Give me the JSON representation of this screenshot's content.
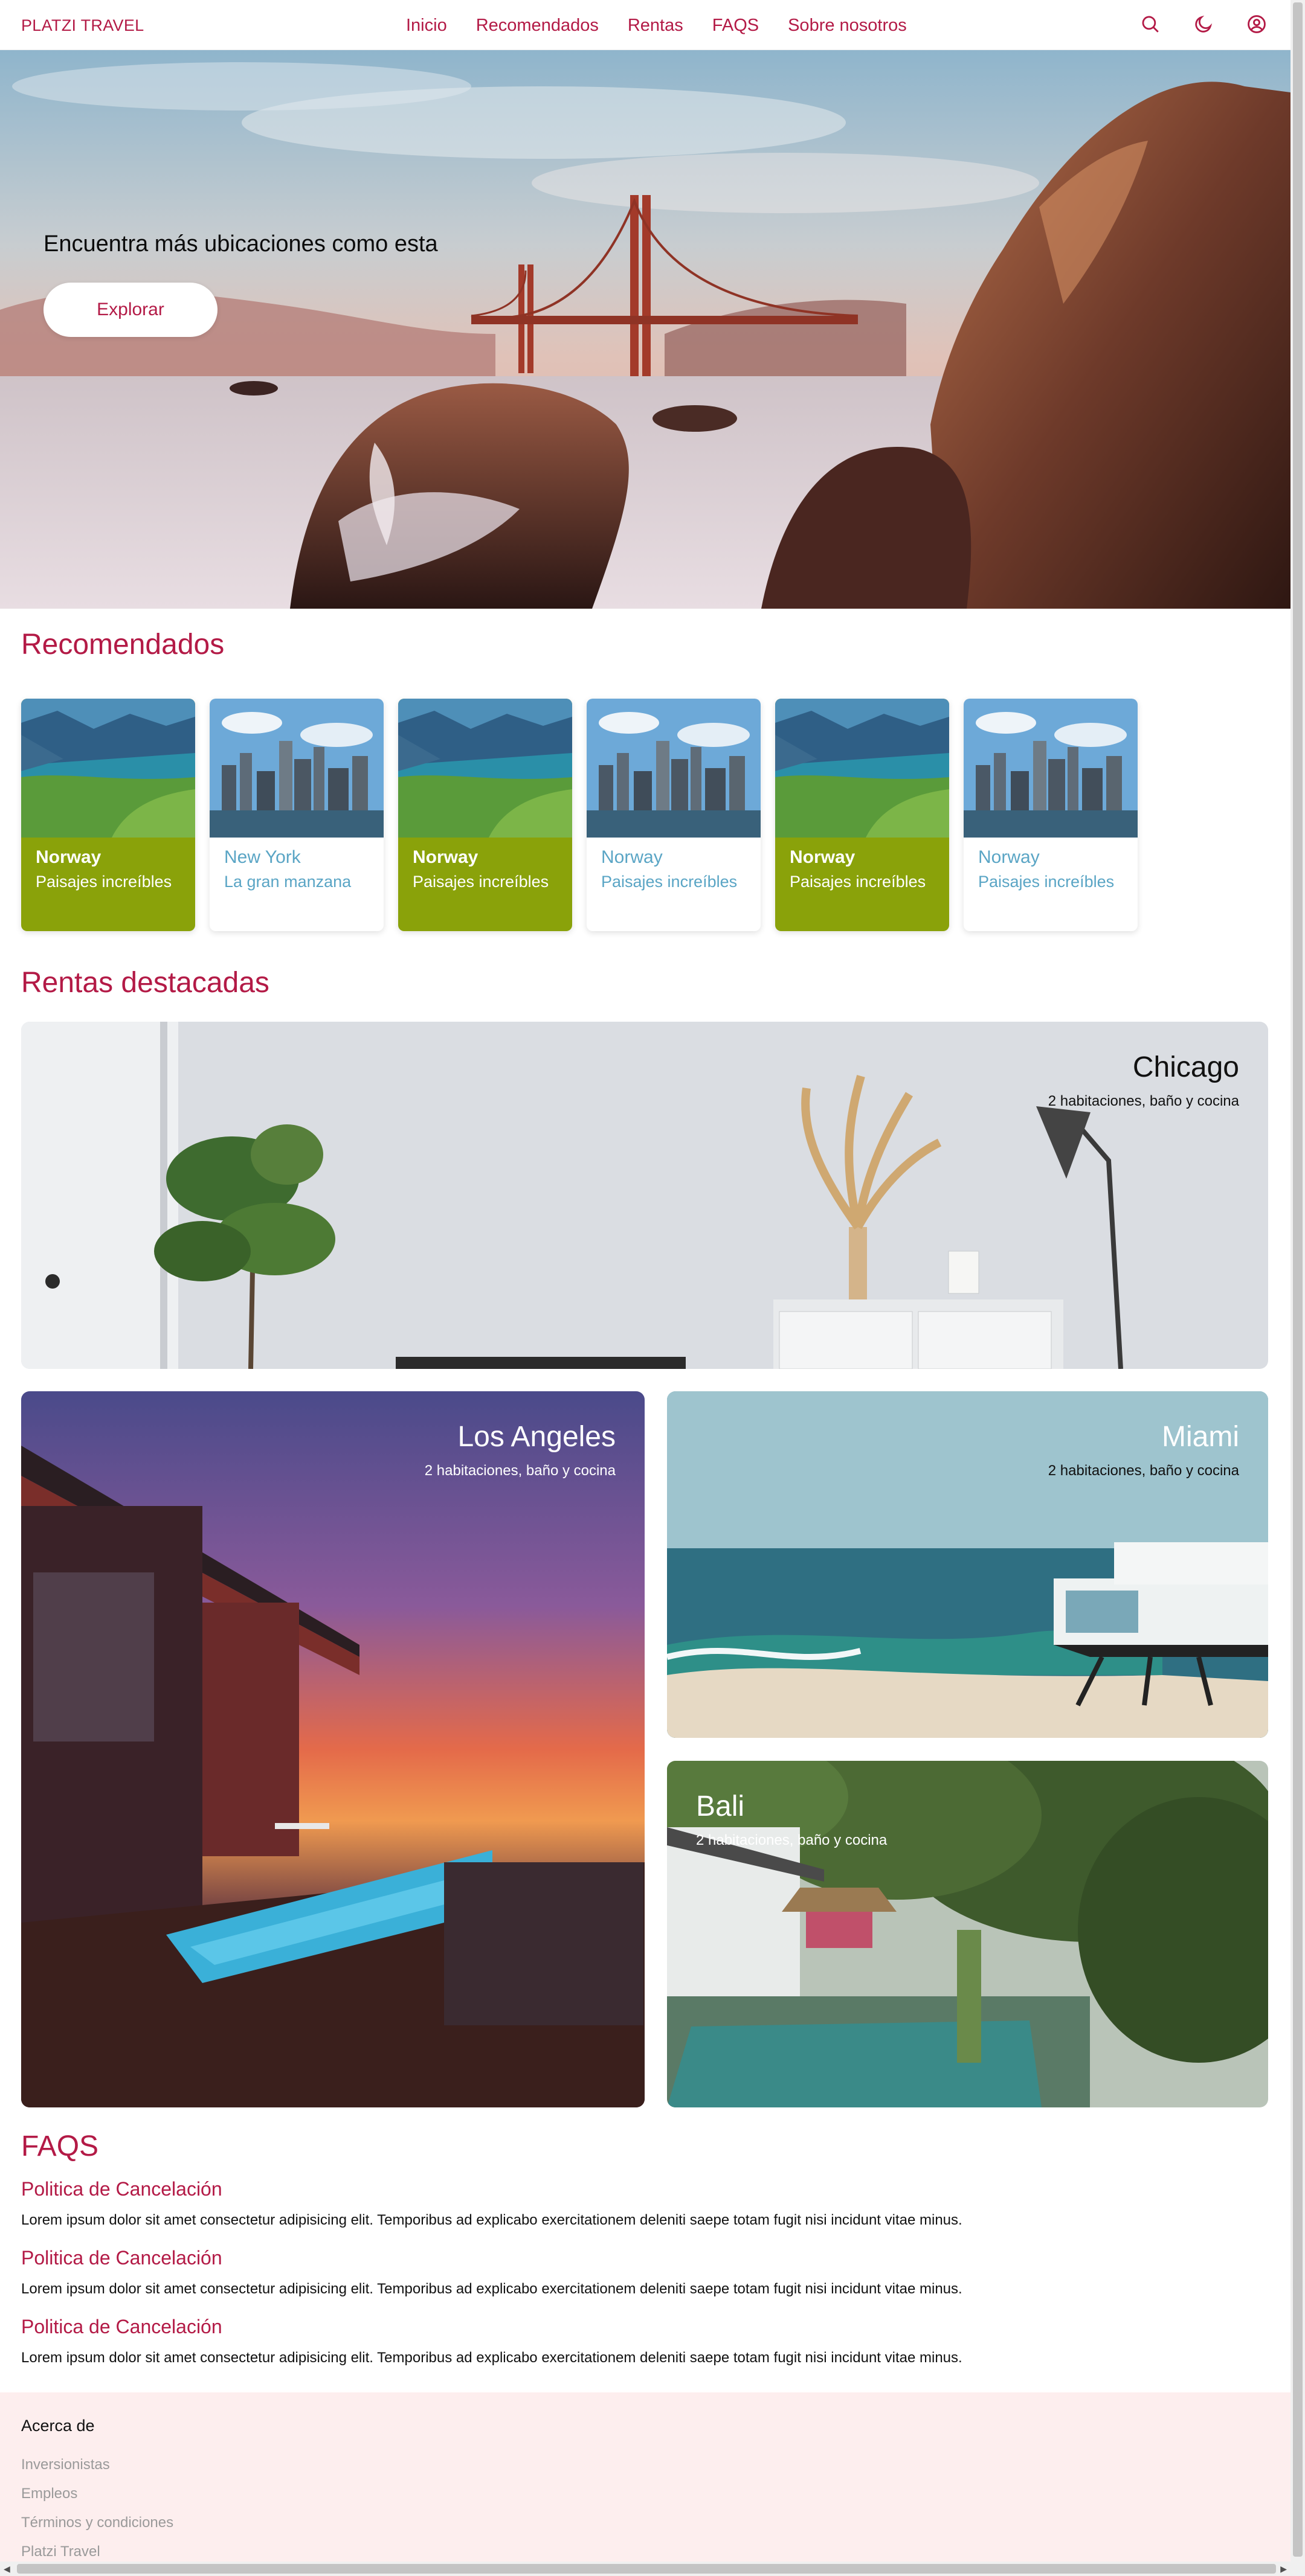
{
  "header": {
    "logo": "PLATZI TRAVEL",
    "nav": [
      "Inicio",
      "Recomendados",
      "Rentas",
      "FAQS",
      "Sobre nosotros"
    ],
    "icons": [
      "search-icon",
      "moon-icon",
      "user-icon"
    ]
  },
  "hero": {
    "title": "Encuentra más ubicaciones como esta",
    "button": "Explorar"
  },
  "recommended": {
    "title": "Recomendados",
    "cards": [
      {
        "title": "Norway",
        "subtitle": "Paisajes increíbles"
      },
      {
        "title": "New York",
        "subtitle": "La gran manzana"
      },
      {
        "title": "Norway",
        "subtitle": "Paisajes increíbles"
      },
      {
        "title": "Norway",
        "subtitle": "Paisajes increíbles"
      },
      {
        "title": "Norway",
        "subtitle": "Paisajes increíbles"
      },
      {
        "title": "Norway",
        "subtitle": "Paisajes increíbles"
      }
    ]
  },
  "rentals": {
    "title": "Rentas destacadas",
    "items": [
      {
        "city": "Chicago",
        "desc": "2 habitaciones, baño y cocina"
      },
      {
        "city": "Los Angeles",
        "desc": "2 habitaciones, baño y cocina"
      },
      {
        "city": "Miami",
        "desc": "2 habitaciones, baño y cocina"
      },
      {
        "city": "Bali",
        "desc": "2 habitaciones, baño y cocina"
      }
    ]
  },
  "faqs": {
    "title": "FAQS",
    "items": [
      {
        "q": "Politica de Cancelación",
        "a": "Lorem ipsum dolor sit amet consectetur adipisicing elit. Temporibus ad explicabo exercitationem deleniti saepe totam fugit nisi incidunt vitae minus."
      },
      {
        "q": "Politica de Cancelación",
        "a": "Lorem ipsum dolor sit amet consectetur adipisicing elit. Temporibus ad explicabo exercitationem deleniti saepe totam fugit nisi incidunt vitae minus."
      },
      {
        "q": "Politica de Cancelación",
        "a": "Lorem ipsum dolor sit amet consectetur adipisicing elit. Temporibus ad explicabo exercitationem deleniti saepe totam fugit nisi incidunt vitae minus."
      }
    ]
  },
  "footer": {
    "heading": "Acerca de",
    "links": [
      "Inversionistas",
      "Empleos",
      "Términos y condiciones",
      "Platzi Travel"
    ]
  },
  "colors": {
    "accent": "#b31a46",
    "card_green": "#8aa20a",
    "card_text_blue": "#5aa5c5",
    "footer_bg": "#fdeeee"
  }
}
